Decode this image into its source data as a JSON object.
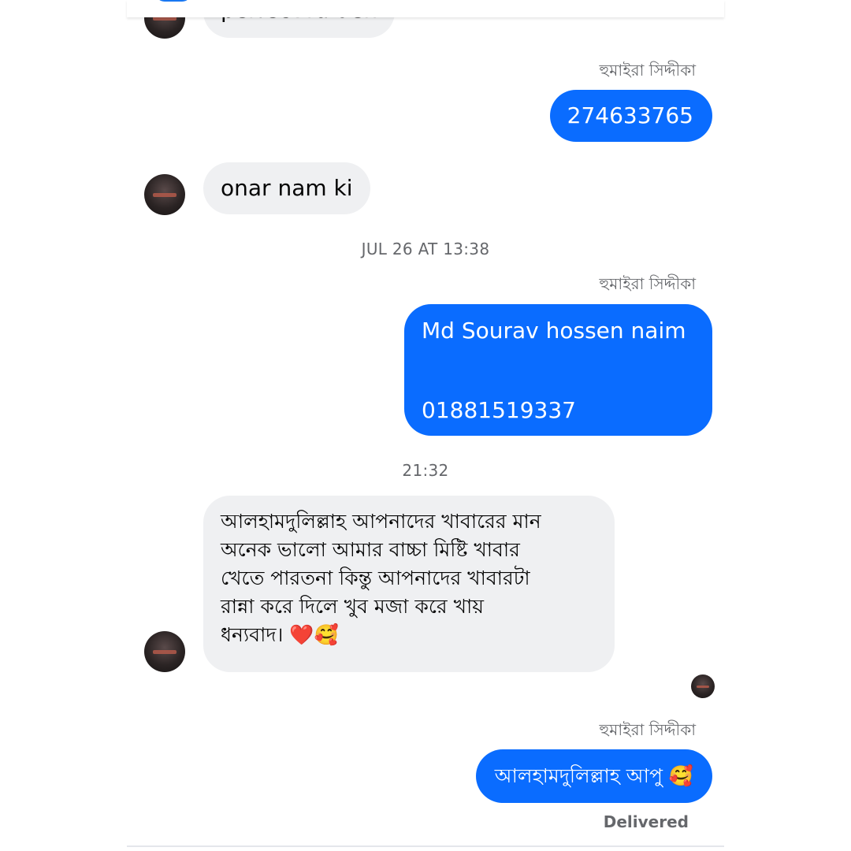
{
  "thread": {
    "top_partial_message": "perfect ra den",
    "messages": [
      {
        "id": "m1",
        "direction": "outgoing",
        "sender_label": "হুমাইরা সিদ্দীকা",
        "text": "274633765"
      },
      {
        "id": "m2",
        "direction": "incoming",
        "text": "onar nam ki"
      },
      {
        "id": "t1",
        "type": "timestamp",
        "text": "JUL 26 AT 13:38"
      },
      {
        "id": "m3",
        "direction": "outgoing",
        "sender_label": "হুমাইরা সিদ্দীকা",
        "line1": "Md Sourav hossen naim",
        "line2": "01881519337"
      },
      {
        "id": "t2",
        "type": "timestamp",
        "text": "21:32"
      },
      {
        "id": "m4",
        "direction": "incoming",
        "lines": [
          "আলহামদুলিল্লাহ আপনাদের খাবারের মান",
          "অনেক ভালো আমার বাচ্চা মিষ্টি খাবার",
          "খেতে পারতনা কিন্তু আপনাদের খাবারটা",
          "রান্না করে দিলে খুব মজা করে খায়",
          "ধন্যবাদ। ❤️🥰"
        ]
      },
      {
        "id": "m5",
        "direction": "outgoing",
        "sender_label": "হুমাইরা সিদ্দীকা",
        "text": "আলহামদুলিল্লাহ আপু 🥰"
      }
    ],
    "status": "Delivered"
  },
  "colors": {
    "outgoing_bubble": "#0a6cff",
    "incoming_bubble": "#eff0f2",
    "meta_text": "#65676b",
    "accent": "#1877f2"
  },
  "icons": {
    "contact_avatar": "contact-avatar-icon",
    "seen_indicator": "seen-avatar-icon"
  }
}
